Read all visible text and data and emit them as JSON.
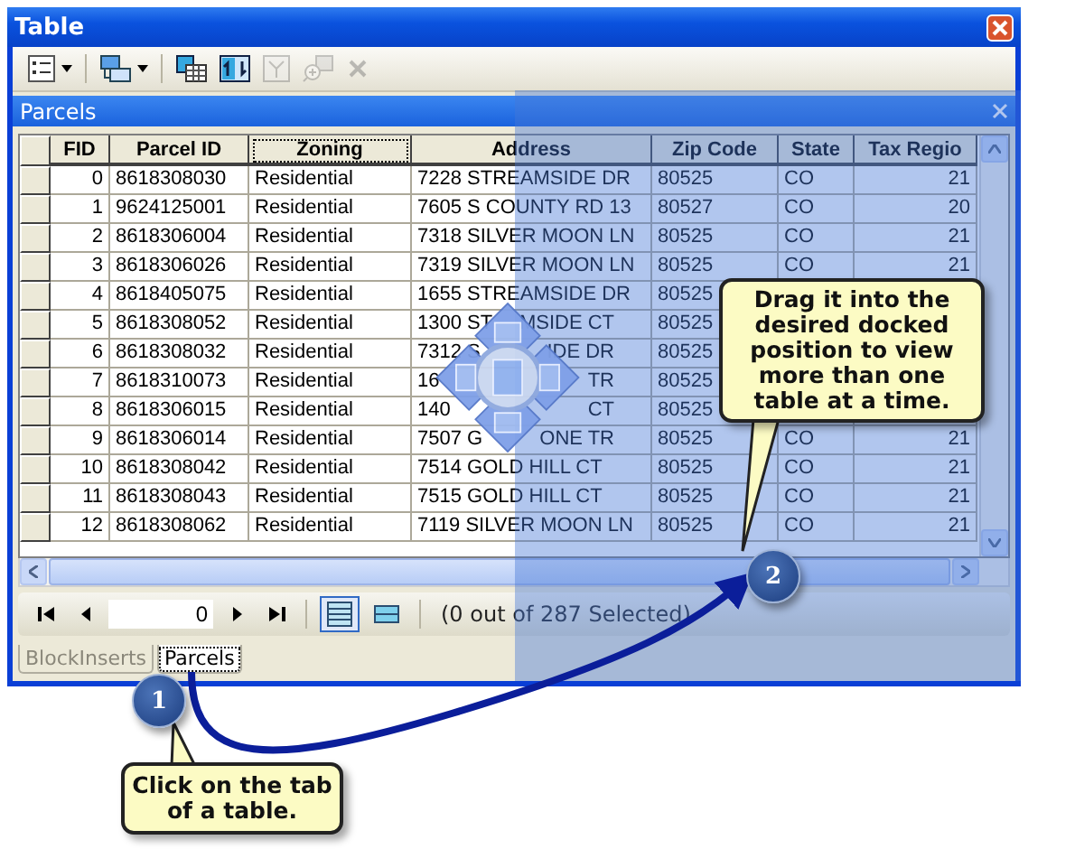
{
  "window": {
    "title": "Table"
  },
  "toolbar": [
    {
      "kind": "table-options",
      "caret": true,
      "disabled": false
    },
    {
      "kind": "related-tables",
      "caret": true,
      "disabled": false
    },
    {
      "kind": "select-by-attributes",
      "caret": false,
      "disabled": false
    },
    {
      "kind": "switch-selection",
      "caret": false,
      "disabled": false
    },
    {
      "kind": "clear-selection",
      "caret": false,
      "disabled": true
    },
    {
      "kind": "zoom-selected",
      "caret": false,
      "disabled": true
    },
    {
      "kind": "delete-selected",
      "caret": false,
      "disabled": true
    }
  ],
  "table": {
    "name": "Parcels",
    "columns": [
      {
        "label": "FID",
        "selected": false
      },
      {
        "label": "Parcel ID",
        "selected": false
      },
      {
        "label": "Zoning",
        "selected": true
      },
      {
        "label": "Address",
        "selected": false
      },
      {
        "label": "Zip Code",
        "selected": false
      },
      {
        "label": "State",
        "selected": false
      },
      {
        "label": "Tax Regio",
        "selected": false
      }
    ],
    "rows": [
      {
        "fid": "0",
        "parcel_id": "8618308030",
        "zoning": "Residential",
        "address": "7228 STREAMSIDE DR",
        "zip": "80525",
        "state": "CO",
        "tax_region": "21"
      },
      {
        "fid": "1",
        "parcel_id": "9624125001",
        "zoning": "Residential",
        "address": "7605 S COUNTY RD 13",
        "zip": "80527",
        "state": "CO",
        "tax_region": "20"
      },
      {
        "fid": "2",
        "parcel_id": "8618306004",
        "zoning": "Residential",
        "address": "7318 SILVER MOON LN",
        "zip": "80525",
        "state": "CO",
        "tax_region": "21"
      },
      {
        "fid": "3",
        "parcel_id": "8618306026",
        "zoning": "Residential",
        "address": "7319 SILVER MOON LN",
        "zip": "80525",
        "state": "CO",
        "tax_region": "21"
      },
      {
        "fid": "4",
        "parcel_id": "8618405075",
        "zoning": "Residential",
        "address": "1655 STREAMSIDE DR",
        "zip": "80525"
      },
      {
        "fid": "5",
        "parcel_id": "8618308052",
        "zoning": "Residential",
        "address": "1300 ST",
        "address_end": "MSIDE CT",
        "zip": "80525"
      },
      {
        "fid": "6",
        "parcel_id": "8618308032",
        "zoning": "Residential",
        "address": "7312 S",
        "address_end": "IDE DR",
        "zip": "80525"
      },
      {
        "fid": "7",
        "parcel_id": "8618310073",
        "zoning": "Residential",
        "address": "16",
        "address_end": "TR",
        "zip": "80525"
      },
      {
        "fid": "8",
        "parcel_id": "8618306015",
        "zoning": "Residential",
        "address": "140",
        "address_end": "CT",
        "zip": "80525"
      },
      {
        "fid": "9",
        "parcel_id": "8618306014",
        "zoning": "Residential",
        "address": "7507 G",
        "address_end": "ONE TR",
        "zip": "80525",
        "state": "CO",
        "tax_region": "21"
      },
      {
        "fid": "10",
        "parcel_id": "8618308042",
        "zoning": "Residential",
        "address": "7514 GOLD HILL CT",
        "zip": "80525",
        "state": "CO",
        "tax_region": "21"
      },
      {
        "fid": "11",
        "parcel_id": "8618308043",
        "zoning": "Residential",
        "address": "7515 GOLD HILL CT",
        "zip": "80525",
        "state": "CO",
        "tax_region": "21"
      },
      {
        "fid": "12",
        "parcel_id": "8618308062",
        "zoning": "Residential",
        "address": "7119 SILVER MOON LN",
        "zip": "80525",
        "state": "CO",
        "tax_region": "21"
      }
    ]
  },
  "navigator": {
    "record": "0",
    "views": [
      {
        "kind": "all",
        "selected": true
      },
      {
        "kind": "selected",
        "selected": false
      }
    ],
    "status": "(0 out of 287 Selected)"
  },
  "tabs": [
    {
      "label": "BlockInserts",
      "selected": false
    },
    {
      "label": "Parcels",
      "selected": true
    }
  ],
  "callouts": [
    {
      "number": "1",
      "text": "Click on the tab of a table."
    },
    {
      "number": "2",
      "text": "Drag it into the desired docked position to view more than one table at a time."
    }
  ]
}
